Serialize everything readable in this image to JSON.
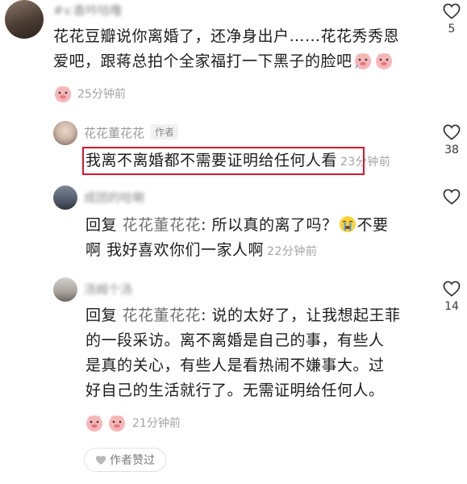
{
  "comments": [
    {
      "username": "#v.香吟咕噜",
      "text": "花花豆瓣说你离婚了，还净身出户……花花秀秀恩爱吧，跟蒋总拍个全家福打一下黑子的脸吧",
      "emojis": [
        "pig-face-emoji",
        "pig-face-emoji"
      ],
      "time": "25分钟前",
      "likes": "5"
    },
    {
      "username": "花花董花花",
      "author_tag": "作者",
      "text": "我离不离婚都不需要证明给任何人看",
      "time": "23分钟前",
      "likes": "38"
    },
    {
      "username": "成团的哈喇",
      "reply_prefix": "回复 ",
      "reply_target": "花花董花花",
      "text_before_emoji": ": 所以真的离了吗？",
      "text_after_emoji": "不要",
      "text_line2": "啊 我好喜欢你们一家人啊",
      "time": "22分钟前",
      "likes": ""
    },
    {
      "username": "汤姆个汤",
      "reply_prefix": "回复 ",
      "reply_target": "花花董花花",
      "text_line1": ": 说的太好了，让我想起王菲",
      "text_line2": "的一段采访。离不离婚是自己的事，有些人",
      "text_line3": "是真的关心，有些人是看热闹不嫌事大。过",
      "text_line4": "好自己的生活就行了。无需证明给任何人。",
      "time": "21分钟前",
      "likes": "14",
      "author_liked_label": "作者赞过"
    }
  ],
  "colors": {
    "highlight": "#d6182e",
    "muted": "#a3a3a3"
  }
}
